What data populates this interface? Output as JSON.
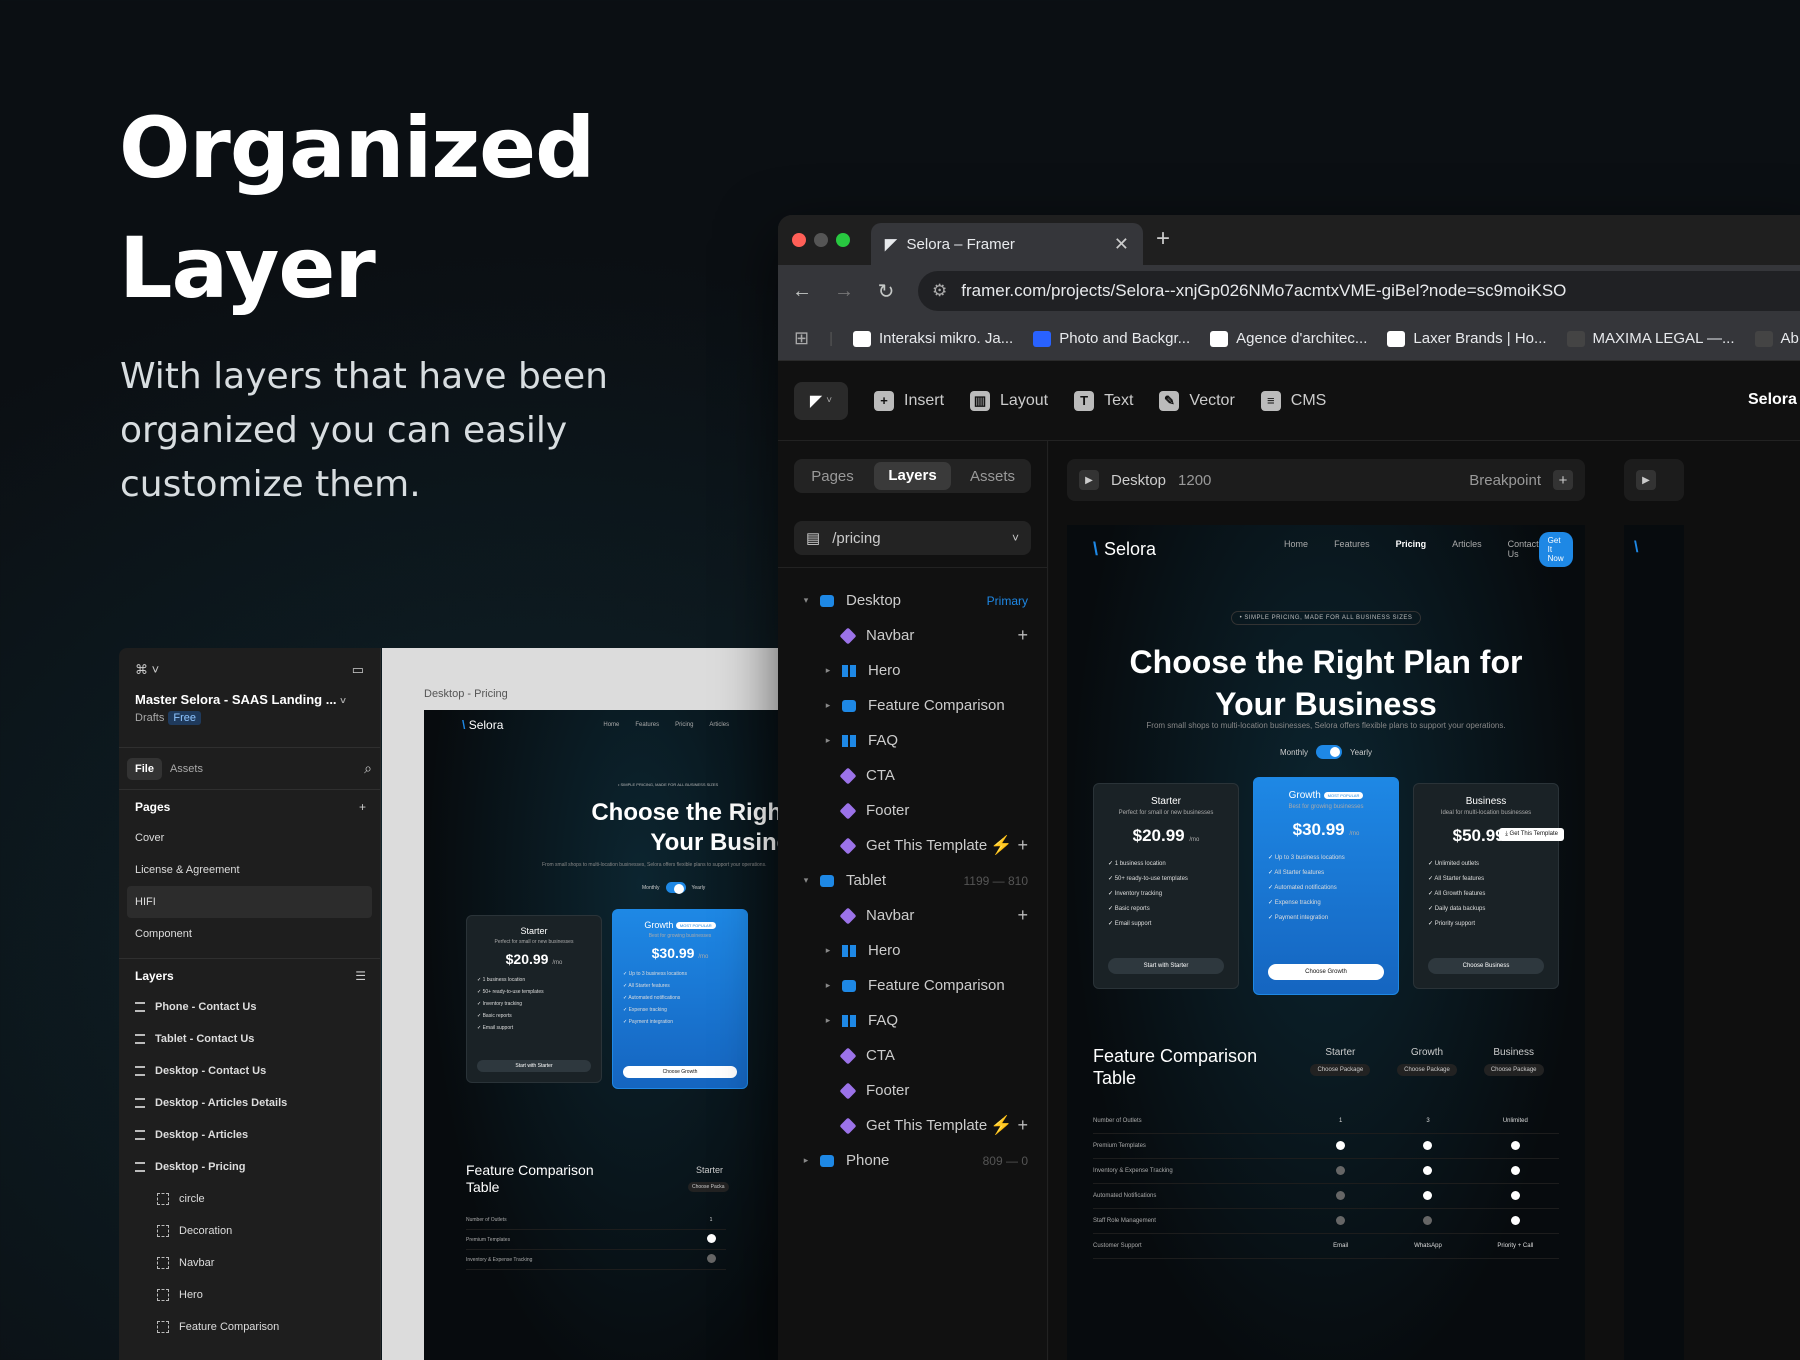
{
  "hero": {
    "title_line1": "Organized",
    "title_line2": "Layer",
    "subtitle": "With layers that have been organized you can easily customize them."
  },
  "browser": {
    "tab_title": "Selora – Framer",
    "url": "framer.com/projects/Selora--xnjGp026NMo7acmtxVME-giBel?node=sc9moiKSO",
    "bookmarks": [
      "Interaksi mikro. Ja...",
      "Photo and Backgr...",
      "Agence d'architec...",
      "Laxer Brands | Ho...",
      "MAXIMA LEGAL —...",
      "Ab"
    ]
  },
  "toolbar": {
    "insert": "Insert",
    "layout": "Layout",
    "text": "Text",
    "vector": "Vector",
    "cms": "CMS",
    "project": "Selora"
  },
  "left_panel": {
    "tabs": [
      "Pages",
      "Layers",
      "Assets"
    ],
    "page_path": "/pricing",
    "layers": [
      {
        "label": "Desktop",
        "type": "stack",
        "level": 0,
        "caret": "▾",
        "meta": "Primary",
        "meta_kind": "tag"
      },
      {
        "label": "Navbar",
        "type": "comp",
        "level": 1,
        "caret": "",
        "meta": "+",
        "meta_kind": "plus"
      },
      {
        "label": "Hero",
        "type": "cols",
        "level": 1,
        "caret": "▸",
        "meta": "",
        "meta_kind": ""
      },
      {
        "label": "Feature Comparison",
        "type": "stack",
        "level": 1,
        "caret": "▸",
        "meta": "",
        "meta_kind": ""
      },
      {
        "label": "FAQ",
        "type": "cols",
        "level": 1,
        "caret": "▸",
        "meta": "",
        "meta_kind": ""
      },
      {
        "label": "CTA",
        "type": "comp",
        "level": 1,
        "caret": "",
        "meta": "",
        "meta_kind": ""
      },
      {
        "label": "Footer",
        "type": "comp",
        "level": 1,
        "caret": "",
        "meta": "",
        "meta_kind": ""
      },
      {
        "label": "Get This Template",
        "type": "comp",
        "level": 1,
        "caret": "",
        "meta": "⚡ +",
        "meta_kind": "plus"
      },
      {
        "label": "Tablet",
        "type": "stack",
        "level": 0,
        "caret": "▾",
        "meta": "1199 — 810",
        "meta_kind": "dim"
      },
      {
        "label": "Navbar",
        "type": "comp",
        "level": 1,
        "caret": "",
        "meta": "+",
        "meta_kind": "plus"
      },
      {
        "label": "Hero",
        "type": "cols",
        "level": 1,
        "caret": "▸",
        "meta": "",
        "meta_kind": ""
      },
      {
        "label": "Feature Comparison",
        "type": "stack",
        "level": 1,
        "caret": "▸",
        "meta": "",
        "meta_kind": ""
      },
      {
        "label": "FAQ",
        "type": "cols",
        "level": 1,
        "caret": "▸",
        "meta": "",
        "meta_kind": ""
      },
      {
        "label": "CTA",
        "type": "comp",
        "level": 1,
        "caret": "",
        "meta": "",
        "meta_kind": ""
      },
      {
        "label": "Footer",
        "type": "comp",
        "level": 1,
        "caret": "",
        "meta": "",
        "meta_kind": ""
      },
      {
        "label": "Get This Template",
        "type": "comp",
        "level": 1,
        "caret": "",
        "meta": "⚡ +",
        "meta_kind": "plus"
      },
      {
        "label": "Phone",
        "type": "stack",
        "level": 0,
        "caret": "▸",
        "meta": "809 — 0",
        "meta_kind": "dim"
      }
    ]
  },
  "canvas": {
    "breakpoint_name": "Desktop",
    "breakpoint_width": "1200",
    "breakpoint_label": "Breakpoint"
  },
  "site": {
    "logo": "Selora",
    "links": [
      "Home",
      "Features",
      "Pricing",
      "Articles",
      "Contact Us"
    ],
    "cta": "Get It Now",
    "eyebrow": "• SIMPLE PRICING, MADE FOR ALL BUSINESS SIZES",
    "h1_line1": "Choose the Right Plan for",
    "h1_line2": "Your Business",
    "sub": "From small shops to multi-location businesses, Selora offers flexible plans to support your operations.",
    "monthly": "Monthly",
    "yearly": "Yearly",
    "plans": [
      {
        "name": "Starter",
        "desc": "Perfect for small or new businesses",
        "price": "$20.99",
        "per": "/mo",
        "features": [
          "1 business location",
          "50+ ready-to-use templates",
          "Inventory tracking",
          "Basic reports",
          "Email support"
        ],
        "button": "Start with Starter"
      },
      {
        "name": "Growth",
        "badge": "MOST POPULAR",
        "desc": "Best for growing businesses",
        "price": "$30.99",
        "per": "/mo",
        "features": [
          "Up to 3 business locations",
          "All Starter features",
          "Automated notifications",
          "Expense tracking",
          "Payment integration"
        ],
        "button": "Choose Growth"
      },
      {
        "name": "Business",
        "desc": "Ideal for multi-location businesses",
        "price": "$50.99",
        "per": "/mo",
        "features": [
          "Unlimited outlets",
          "All Starter features",
          "All Growth features",
          "Daily data backups",
          "Priority support"
        ],
        "button": "Choose Business"
      }
    ],
    "template_tip": "Get This Template",
    "fc_title": "Feature Comparison Table",
    "fc_cols": [
      "Starter",
      "Growth",
      "Business"
    ],
    "fc_choose": "Choose Package",
    "fc_rows": [
      {
        "label": "Number of Outlets",
        "values": [
          "1",
          "3",
          "Unlimited"
        ]
      },
      {
        "label": "Premium Templates",
        "values": [
          "on",
          "on",
          "on"
        ]
      },
      {
        "label": "Inventory & Expense Tracking",
        "values": [
          "off",
          "on",
          "on"
        ]
      },
      {
        "label": "Automated Notifications",
        "values": [
          "off",
          "on",
          "on"
        ]
      },
      {
        "label": "Staff Role Management",
        "values": [
          "off",
          "off",
          "on"
        ]
      },
      {
        "label": "Customer Support",
        "values": [
          "Email",
          "WhatsApp",
          "Priority + Call"
        ]
      }
    ]
  },
  "mini": {
    "project_title": "Master Selora - SAAS Landing ...",
    "drafts": "Drafts",
    "free": "Free",
    "tab_file": "File",
    "tab_assets": "Assets",
    "pages_header": "Pages",
    "pages": [
      "Cover",
      "License & Agreement",
      "HIFI",
      "Component"
    ],
    "layers_header": "Layers",
    "layers": [
      "Phone - Contact Us",
      "Tablet - Contact Us",
      "Desktop - Contact Us",
      "Desktop - Articles Details",
      "Desktop - Articles",
      "Desktop - Pricing"
    ],
    "children": [
      "circle",
      "Decoration",
      "Navbar",
      "Hero",
      "Feature Comparison"
    ],
    "frame_label": "Desktop - Pricing",
    "fc_title": "Feature Comparison Table",
    "fc_col": "Starter",
    "fc_choose": "Choose Packa",
    "fc_rows": [
      {
        "label": "Number of Outlets",
        "value": "1"
      },
      {
        "label": "Premium Templates",
        "value": "on"
      },
      {
        "label": "Inventory & Expense Tracking",
        "value": "off"
      }
    ],
    "h1_line1": "Choose the Right",
    "h1_line2": "Your Busine"
  },
  "colors": {
    "accent": "#1e88e5",
    "component": "#9b72e8"
  }
}
